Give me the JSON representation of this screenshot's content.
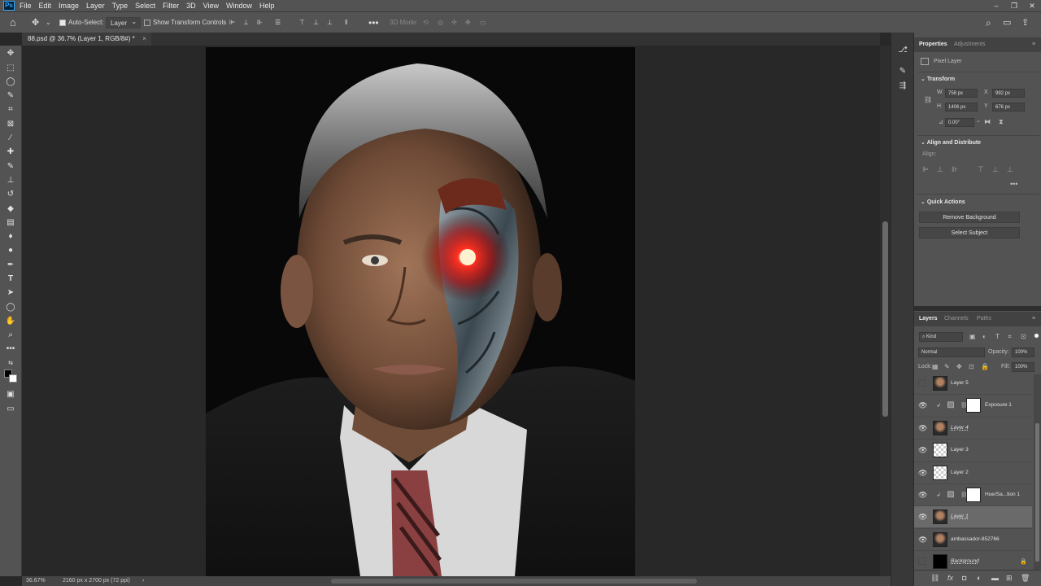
{
  "menubar": {
    "logo": "Ps",
    "items": [
      "File",
      "Edit",
      "Image",
      "Layer",
      "Type",
      "Select",
      "Filter",
      "3D",
      "View",
      "Window",
      "Help"
    ],
    "window_controls": [
      "–",
      "❐",
      "✕"
    ]
  },
  "options": {
    "auto_select_label": "Auto-Select:",
    "auto_select_checked": true,
    "auto_select_target": "Layer",
    "show_transform_label": "Show Transform Controls",
    "mode_3d_label": "3D Mode:",
    "more_label": "•••"
  },
  "document": {
    "tab_title": "88.psd @ 36.7% (Layer 1, RGB/8#) *",
    "close": "×"
  },
  "status": {
    "zoom": "36.67%",
    "doc_info": "2160 px x 2700 px (72 ppi)",
    "arrow": "›"
  },
  "properties": {
    "tabs": [
      "Properties",
      "Adjustments"
    ],
    "active_tab": "Properties",
    "layer_kind": "Pixel Layer",
    "transform_title": "Transform",
    "w_label": "W",
    "w_value": "758 px",
    "h_label": "H",
    "h_value": "1406 px",
    "x_label": "X",
    "x_value": "992 px",
    "y_label": "Y",
    "y_value": "676 px",
    "angle_value": "0.00°",
    "align_title": "Align and Distribute",
    "align_label": "Align:",
    "more": "•••",
    "quick_title": "Quick Actions",
    "remove_bg": "Remove Background",
    "select_subject": "Select Subject"
  },
  "layers_panel": {
    "tabs": [
      "Layers",
      "Channels",
      "Paths"
    ],
    "active_tab": "Layers",
    "kind_filter": "Kind",
    "blend_mode": "Normal",
    "opacity_label": "Opacity:",
    "opacity_value": "100%",
    "lock_label": "Lock:",
    "fill_label": "Fill:",
    "fill_value": "100%",
    "layers": [
      {
        "name": "Layer 5",
        "visible": false,
        "thumb": "face",
        "italic": false,
        "selected": false,
        "clip": false,
        "mask": false
      },
      {
        "name": "Exposure 1",
        "visible": true,
        "thumb": "adjust",
        "italic": false,
        "selected": false,
        "clip": true,
        "mask": true
      },
      {
        "name": "Layer 4",
        "visible": true,
        "thumb": "face",
        "italic": true,
        "selected": false,
        "clip": false,
        "mask": false
      },
      {
        "name": "Layer 3",
        "visible": true,
        "thumb": "checker",
        "italic": false,
        "selected": false,
        "clip": false,
        "mask": false
      },
      {
        "name": "Layer 2",
        "visible": true,
        "thumb": "checker",
        "italic": false,
        "selected": false,
        "clip": false,
        "mask": false
      },
      {
        "name": "Hue/Sa...tion 1",
        "visible": true,
        "thumb": "adjust",
        "italic": false,
        "selected": false,
        "clip": true,
        "mask": true
      },
      {
        "name": "Layer 1",
        "visible": true,
        "thumb": "face",
        "italic": true,
        "selected": true,
        "clip": false,
        "mask": false
      },
      {
        "name": "ambassador-852766",
        "visible": true,
        "thumb": "face",
        "italic": false,
        "selected": false,
        "clip": false,
        "mask": false
      },
      {
        "name": "Background",
        "visible": false,
        "thumb": "black",
        "italic": true,
        "selected": false,
        "clip": false,
        "mask": false,
        "locked": true
      }
    ]
  }
}
